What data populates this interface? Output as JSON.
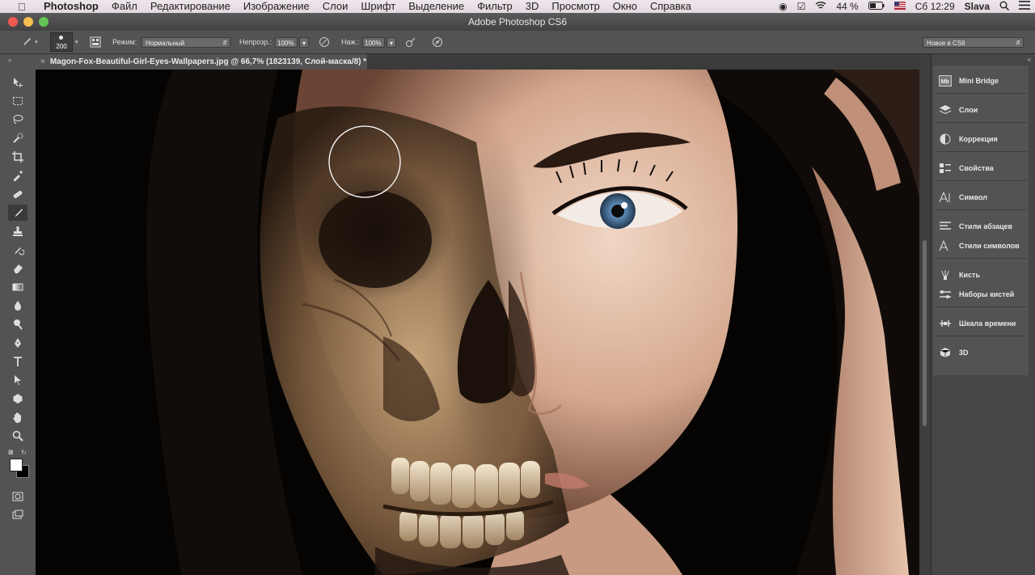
{
  "menubar": {
    "app_name": "Photoshop",
    "items": [
      "Файл",
      "Редактирование",
      "Изображение",
      "Слои",
      "Шрифт",
      "Выделение",
      "Фильтр",
      "3D",
      "Просмотр",
      "Окно",
      "Справка"
    ],
    "battery": "44 %",
    "clock": "Сб 12:29",
    "user": "Slava"
  },
  "window": {
    "title": "Adobe Photoshop CS6"
  },
  "options_bar": {
    "brush_size": "200",
    "mode_label": "Режим:",
    "mode_value": "Нормальный",
    "opacity_label": "Непрозр.:",
    "opacity_value": "100%",
    "flow_label": "Наж.:",
    "flow_value": "100%",
    "workspace": "Новое в CS6"
  },
  "document": {
    "tab_title": "Magon-Fox-Beautiful-Girl-Eyes-Wallpapers.jpg @ 66,7% (1823139, Слой-маска/8) *"
  },
  "right_panel": {
    "items": [
      {
        "label": "Mini Bridge",
        "icon": "mini-bridge-icon"
      },
      {
        "label": "Слои",
        "icon": "layers-icon"
      },
      {
        "label": "Коррекция",
        "icon": "adjustments-icon"
      },
      {
        "label": "Свойства",
        "icon": "properties-icon"
      },
      {
        "label": "Символ",
        "icon": "character-icon"
      },
      {
        "label": "Стили абзацев",
        "icon": "paragraph-styles-icon"
      },
      {
        "label": "Стили символов",
        "icon": "character-styles-icon"
      },
      {
        "label": "Кисть",
        "icon": "brush-icon"
      },
      {
        "label": "Наборы кистей",
        "icon": "brush-presets-icon"
      },
      {
        "label": "Шкала времени",
        "icon": "timeline-icon"
      },
      {
        "label": "3D",
        "icon": "3d-icon"
      }
    ]
  },
  "colors": {
    "foreground": "#ffffff",
    "background": "#000000",
    "close": "#ee5a52",
    "minimize": "#f5bf4f",
    "zoom": "#62c554"
  }
}
